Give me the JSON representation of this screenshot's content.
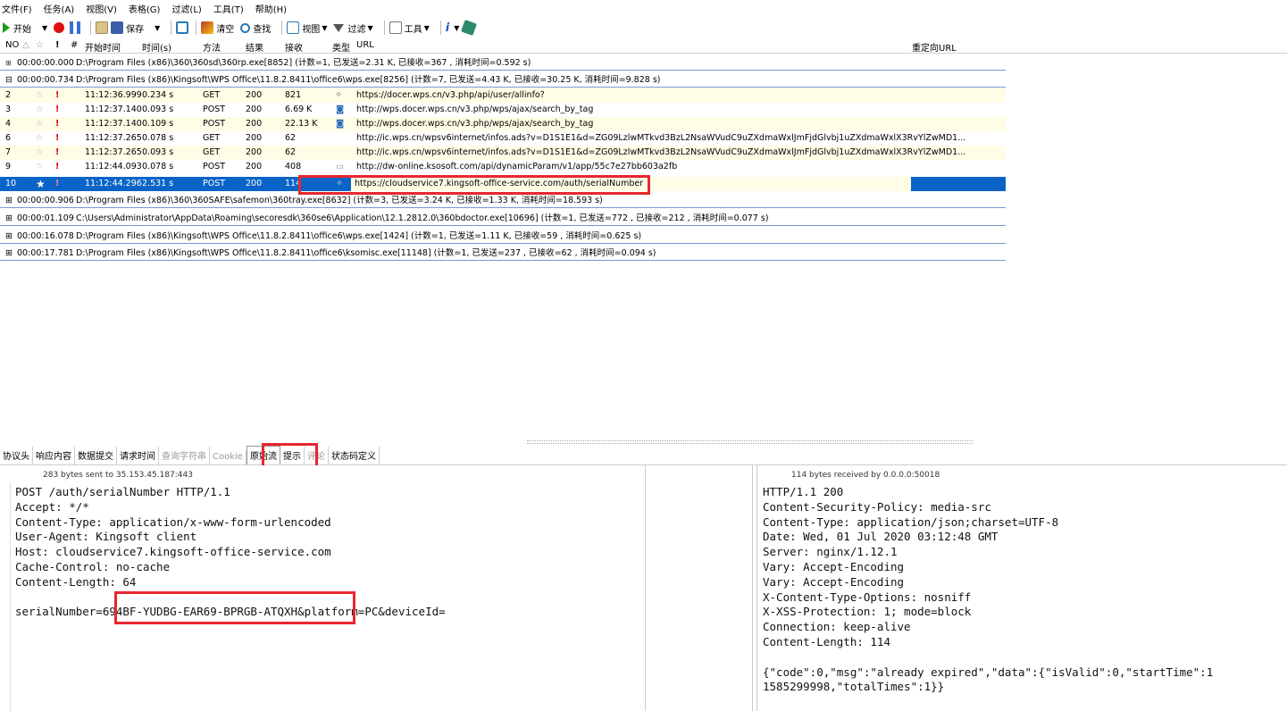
{
  "menu": [
    "文件(F)",
    "任务(A)",
    "视图(V)",
    "表格(G)",
    "过滤(L)",
    "工具(T)",
    "帮助(H)"
  ],
  "toolbar": {
    "start": "开始",
    "save": "保存",
    "clear": "清空",
    "find": "查找",
    "view": "视图",
    "filter": "过滤",
    "tools": "工具"
  },
  "columns": {
    "no": "NO",
    "hash": "#",
    "start_time": "开始时间",
    "duration": "时间(s)",
    "method": "方法",
    "result": "结果",
    "received": "接收",
    "type": "类型",
    "url": "URL",
    "redirect": "重定向URL"
  },
  "groups": [
    {
      "time": "00:00:00.000",
      "text": "D:\\Program Files (x86)\\360\\360sd\\360rp.exe[8852]  (计数=1, 已发送=2.31 K, 已接收=367 , 消耗时间=0.592 s)",
      "sign": "⊞"
    },
    {
      "time": "00:00:00.734",
      "text": "D:\\Program Files (x86)\\Kingsoft\\WPS Office\\11.8.2.8411\\office6\\wps.exe[8256]  (计数=7, 已发送=4.43 K, 已接收=30.25 K, 消耗时间=9.828 s)",
      "sign": "⊟"
    },
    {
      "time": "00:00:00.906",
      "text": "D:\\Program Files (x86)\\360\\360SAFE\\safemon\\360tray.exe[8632]  (计数=3, 已发送=3.24 K, 已接收=1.33 K, 消耗时间=18.593 s)",
      "sign": "⊞"
    },
    {
      "time": "00:00:01.109",
      "text": "C:\\Users\\Administrator\\AppData\\Roaming\\secoresdk\\360se6\\Application\\12.1.2812.0\\360bdoctor.exe[10696]  (计数=1, 已发送=772 , 已接收=212 , 消耗时间=0.077 s)",
      "sign": "⊞"
    },
    {
      "time": "00:00:16.078",
      "text": "D:\\Program Files (x86)\\Kingsoft\\WPS Office\\11.8.2.8411\\office6\\wps.exe[1424]  (计数=1, 已发送=1.11 K, 已接收=59 , 消耗时间=0.625 s)",
      "sign": "⊞"
    },
    {
      "time": "00:00:17.781",
      "text": "D:\\Program Files (x86)\\Kingsoft\\WPS Office\\11.8.2.8411\\office6\\ksomisc.exe[11148]  (计数=1, 已发送=237 , 已接收=62 , 消耗时间=0.094 s)",
      "sign": "⊞"
    }
  ],
  "requests": [
    {
      "no": "2",
      "start": "11:12:36.999",
      "dur": "0.234 s",
      "method": "GET",
      "result": "200",
      "recv": "821",
      "url": "https://docer.wps.cn/v3.php/api/user/allinfo?"
    },
    {
      "no": "3",
      "start": "11:12:37.140",
      "dur": "0.093 s",
      "method": "POST",
      "result": "200",
      "recv": "6.69 K",
      "url": "http://wps.docer.wps.cn/v3.php/wps/ajax/search_by_tag"
    },
    {
      "no": "4",
      "start": "11:12:37.140",
      "dur": "0.109 s",
      "method": "POST",
      "result": "200",
      "recv": "22.13 K",
      "url": "http://wps.docer.wps.cn/v3.php/wps/ajax/search_by_tag"
    },
    {
      "no": "6",
      "start": "11:12:37.265",
      "dur": "0.078 s",
      "method": "GET",
      "result": "200",
      "recv": "62",
      "url": "http://ic.wps.cn/wpsv6internet/infos.ads?v=D1S1E1&d=ZG09LzlwMTkvd3BzL2NsaWVudC9uZXdmaWxlJmFjdGlvbj1uZXdmaWxlX3RvYlZwMD1..."
    },
    {
      "no": "7",
      "start": "11:12:37.265",
      "dur": "0.093 s",
      "method": "GET",
      "result": "200",
      "recv": "62",
      "url": "http://ic.wps.cn/wpsv6internet/infos.ads?v=D1S1E1&d=ZG09LzlwMTkvd3BzL2NsaWVudC9uZXdmaWxlJmFjdGlvbj1uZXdmaWxlX3RvYlZwMD1..."
    },
    {
      "no": "9",
      "start": "11:12:44.093",
      "dur": "0.078 s",
      "method": "POST",
      "result": "200",
      "recv": "408",
      "url": "http://dw-online.ksosoft.com/api/dynamicParam/v1/app/55c7e27bb603a2fb"
    },
    {
      "no": "10",
      "start": "11:12:44.296",
      "dur": "2.531 s",
      "method": "POST",
      "result": "200",
      "recv": "114",
      "url": "https://cloudservice7.kingsoft-office-service.com/auth/serialNumber"
    }
  ],
  "tabs": [
    {
      "label": "协议头",
      "disabled": false
    },
    {
      "label": "响应内容",
      "disabled": false
    },
    {
      "label": "数据提交",
      "disabled": false
    },
    {
      "label": "请求时间",
      "disabled": false
    },
    {
      "label": "查询字符串",
      "disabled": true
    },
    {
      "label": "Cookie",
      "disabled": true
    },
    {
      "label": "原始流",
      "disabled": false,
      "active": true
    },
    {
      "label": "提示",
      "disabled": false
    },
    {
      "label": "评论",
      "disabled": true
    },
    {
      "label": "状态码定义",
      "disabled": false
    }
  ],
  "left_pane": {
    "header": "283 bytes sent to 35.153.45.187:443",
    "text": "POST /auth/serialNumber HTTP/1.1\nAccept: */*\nContent-Type: application/x-www-form-urlencoded\nUser-Agent: Kingsoft client\nHost: cloudservice7.kingsoft-office-service.com\nCache-Control: no-cache\nContent-Length: 64\n\nserialNumber=694BF-YUDBG-EAR69-BPRGB-ATQXH&platform=PC&deviceId="
  },
  "right_pane": {
    "header": "114 bytes received by 0.0.0.0:50018",
    "text": "HTTP/1.1 200\nContent-Security-Policy: media-src\nContent-Type: application/json;charset=UTF-8\nDate: Wed, 01 Jul 2020 03:12:48 GMT\nServer: nginx/1.12.1\nVary: Accept-Encoding\nVary: Accept-Encoding\nX-Content-Type-Options: nosniff\nX-XSS-Protection: 1; mode=block\nConnection: keep-alive\nContent-Length: 114\n\n{\"code\":0,\"msg\":\"already expired\",\"data\":{\"isValid\":0,\"startTime\":1\n1585299998,\"totalTimes\":1}}"
  },
  "colors": {
    "accent_selected": "#0a64c8",
    "highlight": "#e8262e",
    "group_line": "#7a96d6",
    "row_alt": "#fffde6"
  }
}
